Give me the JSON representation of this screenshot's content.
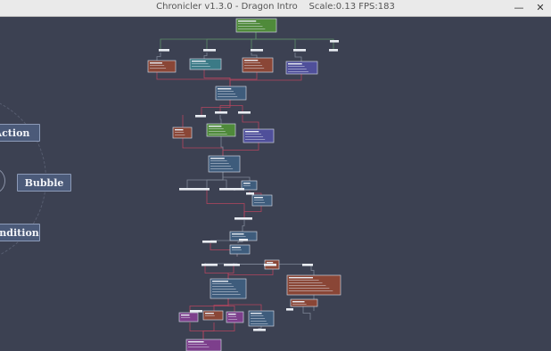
{
  "window": {
    "title": "Chronicler v1.3.0 - Dragon Intro    Scale:0.13 FPS:183",
    "minimize_glyph": "—",
    "close_glyph": "✕"
  },
  "radial_menu": {
    "items": [
      "Action",
      "Bubble",
      "Condition"
    ]
  },
  "colors": {
    "background": "#3c4152",
    "edge_green": "#5d8f69",
    "edge_red": "#b4455f",
    "edge_gray": "#7f8797",
    "node_blue": "#3e5c7c",
    "node_green": "#4f8a3a",
    "node_red": "#8a4636",
    "node_purple": "#4f4f9a",
    "node_teal": "#3b7a86",
    "node_magenta": "#7d3f8c"
  }
}
